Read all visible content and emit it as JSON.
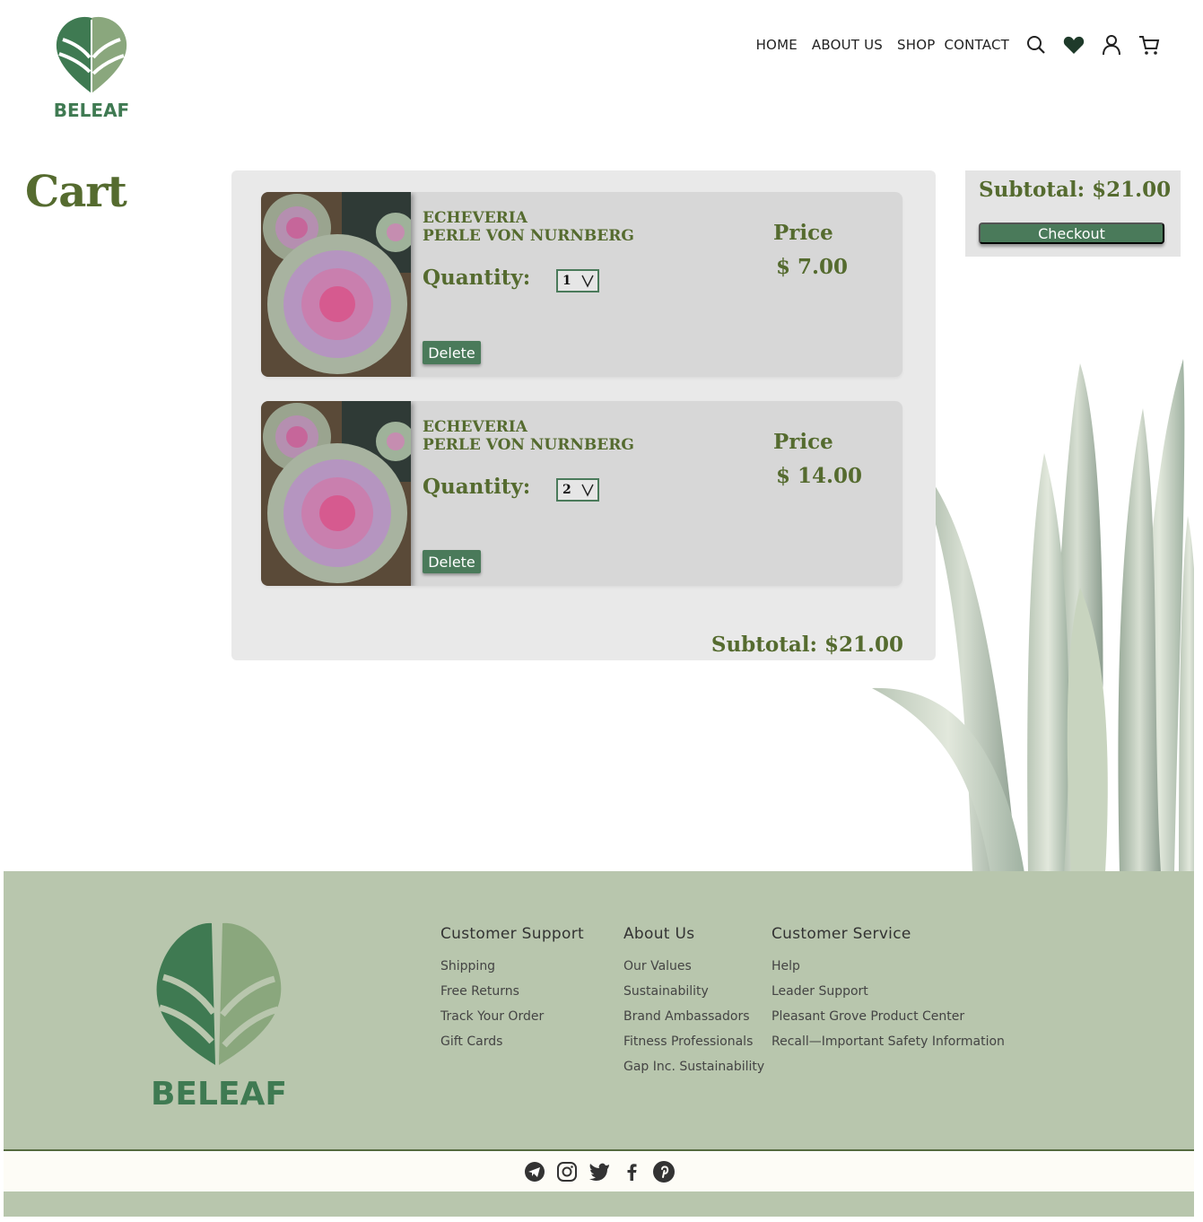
{
  "brand": {
    "name": "BELEAF"
  },
  "nav": {
    "links": [
      "HOME",
      "ABOUT US",
      "SHOP",
      "CONTACT"
    ],
    "icons": [
      "search-icon",
      "heart-icon",
      "user-icon",
      "cart-icon"
    ]
  },
  "page": {
    "title": "Cart"
  },
  "cart": {
    "items": [
      {
        "name_line1": "ECHEVERIA",
        "name_line2": "PERLE VON NURNBERG",
        "quantity_label": "Quantity:",
        "quantity": "1",
        "price_label": "Price",
        "price": "$ 7.00",
        "delete_label": "Delete"
      },
      {
        "name_line1": "ECHEVERIA",
        "name_line2": "PERLE VON NURNBERG",
        "quantity_label": "Quantity:",
        "quantity": "2",
        "price_label": "Price",
        "price": "$ 14.00",
        "delete_label": "Delete"
      }
    ],
    "subtotal": "Subtotal: $21.00"
  },
  "summary": {
    "subtotal": "Subtotal: $21.00",
    "checkout_label": "Checkout"
  },
  "footer": {
    "columns": [
      {
        "title": "Customer Support",
        "links": [
          "Shipping",
          "Free Returns",
          "Track Your Order",
          "Gift Cards"
        ]
      },
      {
        "title": "About Us",
        "links": [
          "Our Values",
          "Sustainability",
          "Brand Ambassadors",
          "Fitness Professionals",
          "Gap Inc. Sustainability"
        ]
      },
      {
        "title": "Customer Service",
        "links": [
          "Help",
          "Leader Support",
          "Pleasant Grove Product Center",
          "Recall—Important Safety Information"
        ]
      }
    ],
    "social": [
      "telegram-icon",
      "instagram-icon",
      "twitter-icon",
      "facebook-icon",
      "pinterest-icon"
    ]
  },
  "colors": {
    "brand_green": "#4a7a5a",
    "olive_text": "#556b2f",
    "footer_bg": "#b8c6ad"
  }
}
